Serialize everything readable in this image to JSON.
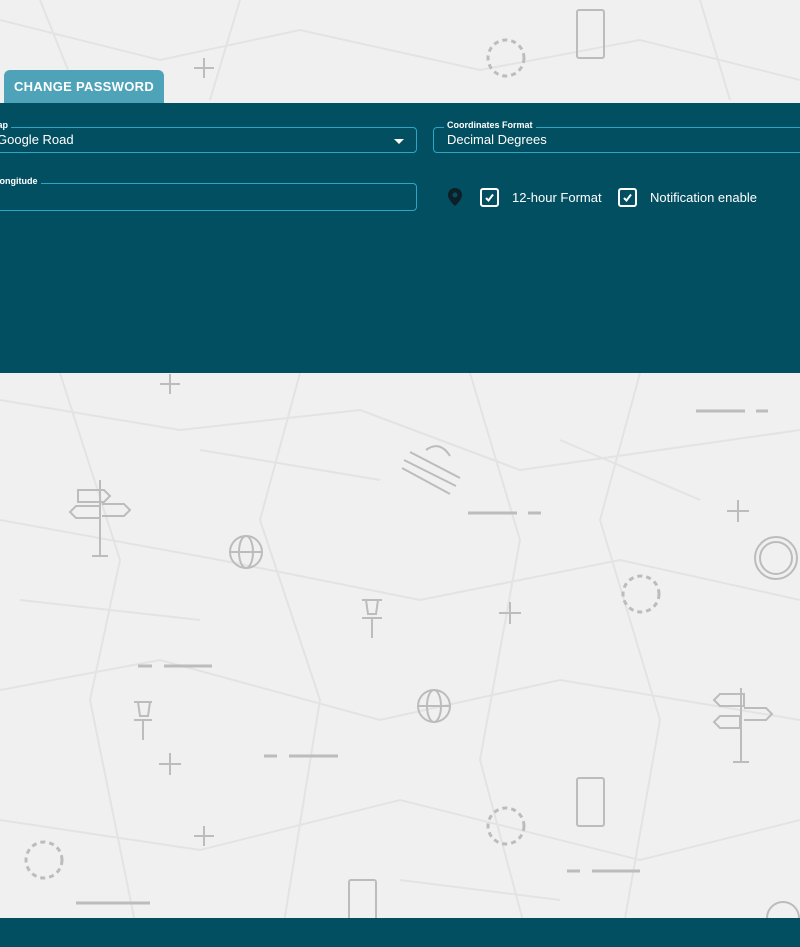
{
  "tabs": {
    "change_password": "CHANGE PASSWORD"
  },
  "settings": {
    "map": {
      "label": "Map",
      "value": "Google Road"
    },
    "coordinates_format": {
      "label": "Coordinates Format",
      "value": "Decimal Degrees"
    },
    "longitude": {
      "label": "Longitude",
      "value": ""
    },
    "twelve_hour_format": {
      "label": "12-hour Format",
      "checked": true
    },
    "notification_enable": {
      "label": "Notification enable",
      "checked": true
    }
  },
  "colors": {
    "panel_background": "#034f62",
    "tab_background": "#4fa3b9",
    "field_border": "#2aa7c7",
    "page_background": "#f0f0f0",
    "pattern_stroke": "#b7b7b7"
  },
  "icons": {
    "location": "location-pin-icon",
    "checkbox": "checkbox-checked-icon",
    "dropdown": "chevron-down-icon"
  }
}
